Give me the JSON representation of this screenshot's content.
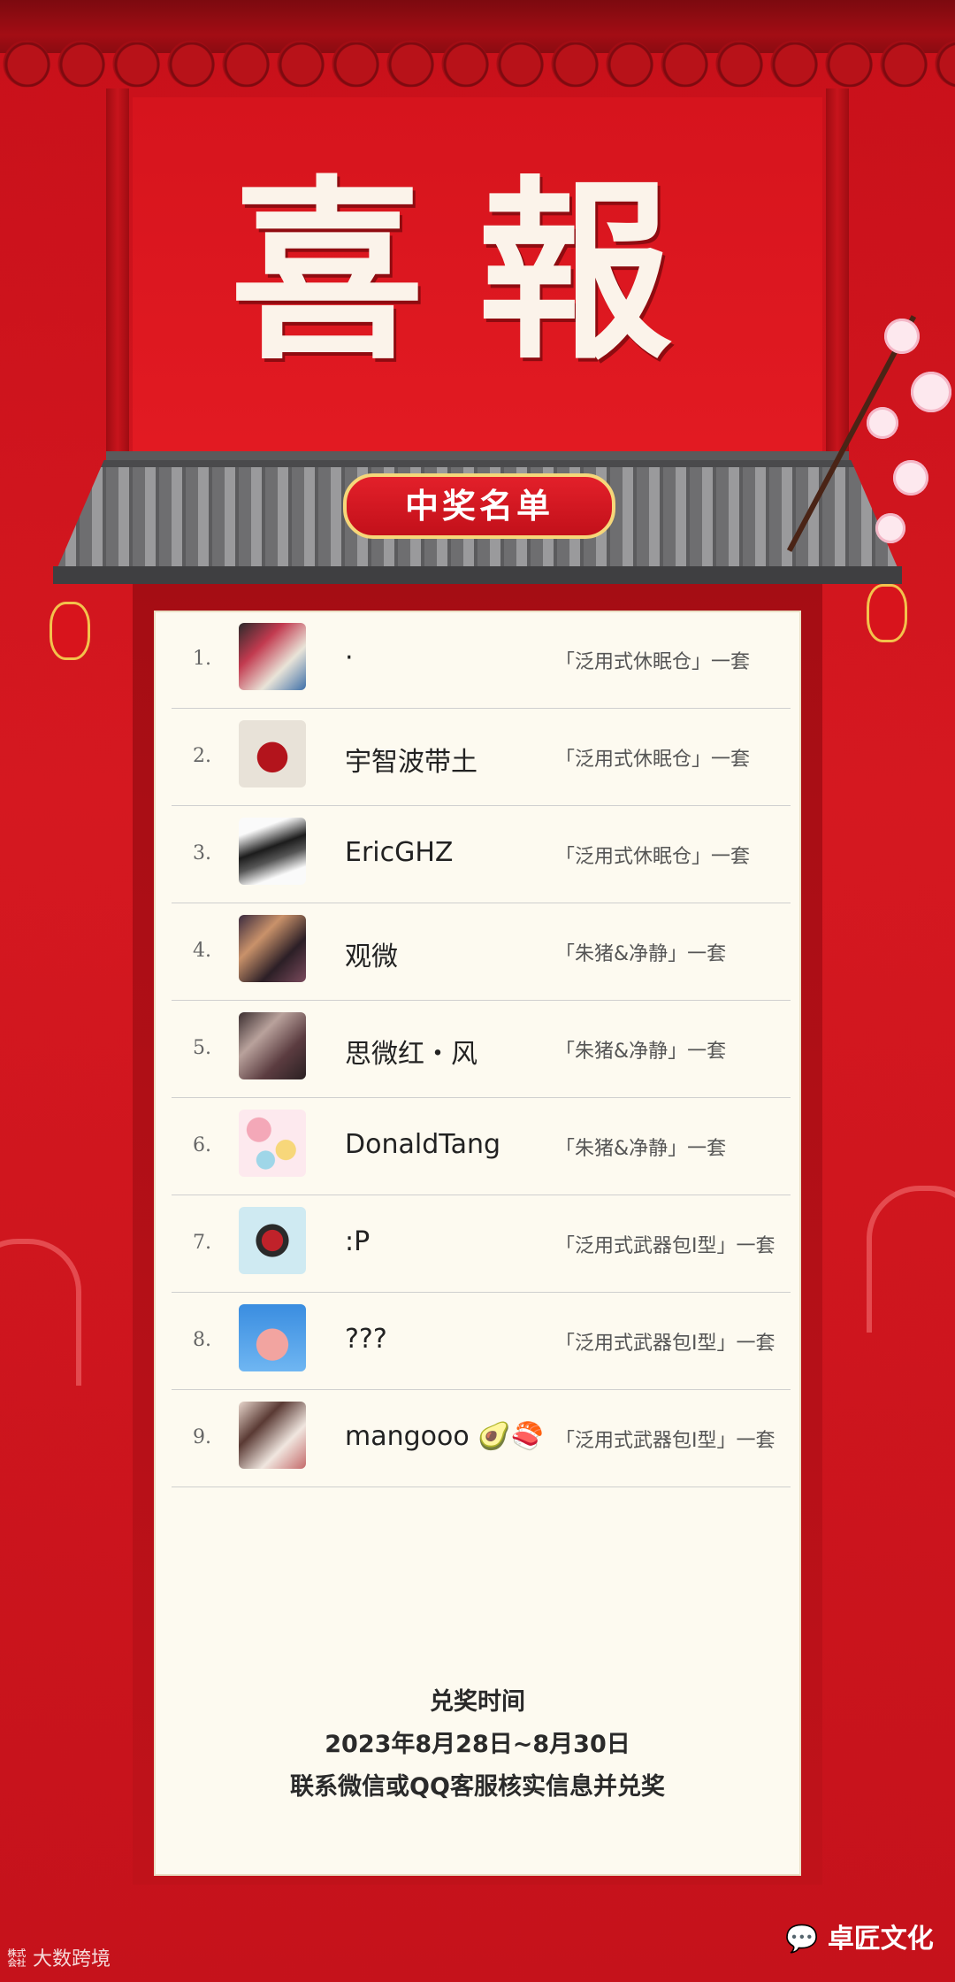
{
  "header": {
    "title": "喜報",
    "banner": "中奖名单"
  },
  "winners": [
    {
      "rank": "1.",
      "nickname": "·",
      "prize": "「泛用式休眠仓」一套"
    },
    {
      "rank": "2.",
      "nickname": "宇智波带土",
      "prize": "「泛用式休眠仓」一套"
    },
    {
      "rank": "3.",
      "nickname": "EricGHZ",
      "prize": "「泛用式休眠仓」一套"
    },
    {
      "rank": "4.",
      "nickname": "观微",
      "prize": "「朱猪&净静」一套"
    },
    {
      "rank": "5.",
      "nickname": "思微红・风",
      "prize": "「朱猪&净静」一套"
    },
    {
      "rank": "6.",
      "nickname": "DonaldTang",
      "prize": "「朱猪&净静」一套"
    },
    {
      "rank": "7.",
      "nickname": ":P",
      "prize": "「泛用式武器包I型」一套"
    },
    {
      "rank": "8.",
      "nickname": "???",
      "prize": "「泛用式武器包I型」一套"
    },
    {
      "rank": "9.",
      "nickname": "mangooo 🥑🍣",
      "prize": "「泛用式武器包I型」一套"
    }
  ],
  "footer": {
    "line1": "兑奖时间",
    "line2": "2023年8月28日~8月30日",
    "line3": "联系微信或QQ客服核实信息并兑奖"
  },
  "watermark": {
    "left": "大数跨境",
    "right": "卓匠文化"
  },
  "colors": {
    "background": "#c8101a",
    "card": "#fdfaf0",
    "accent_gold": "#f6d77a"
  }
}
